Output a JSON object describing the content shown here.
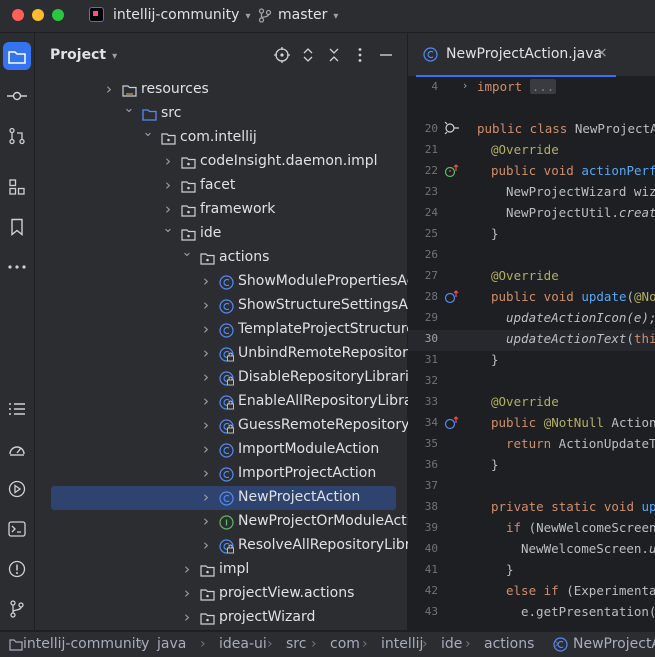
{
  "window": {
    "project_name": "intellij-community",
    "branch": "master"
  },
  "project_panel": {
    "title": "Project",
    "tree": [
      {
        "label": "resources",
        "type": "folder"
      },
      {
        "label": "src",
        "type": "source-folder"
      },
      {
        "label": "com.intellij",
        "type": "package"
      },
      {
        "label": "codeInsight.daemon.impl",
        "type": "package"
      },
      {
        "label": "facet",
        "type": "package"
      },
      {
        "label": "framework",
        "type": "package"
      },
      {
        "label": "ide",
        "type": "package"
      },
      {
        "label": "actions",
        "type": "package"
      },
      {
        "label": "ShowModulePropertiesAction",
        "type": "class"
      },
      {
        "label": "ShowStructureSettingsAction",
        "type": "class"
      },
      {
        "label": "TemplateProjectStructureActi",
        "type": "class"
      },
      {
        "label": "UnbindRemoteRepositoryForA",
        "type": "class-locked"
      },
      {
        "label": "DisableRepositoryLibrariesSha",
        "type": "class-locked"
      },
      {
        "label": "EnableAllRepositoryLibrariesS",
        "type": "class-locked"
      },
      {
        "label": "GuessRemoteRepositoryForEa",
        "type": "class-locked"
      },
      {
        "label": "ImportModuleAction",
        "type": "class"
      },
      {
        "label": "ImportProjectAction",
        "type": "class"
      },
      {
        "label": "NewProjectAction",
        "type": "class",
        "selected": true
      },
      {
        "label": "NewProjectOrModuleAction",
        "type": "interface"
      },
      {
        "label": "ResolveAllRepositoryLibraries",
        "type": "class-locked"
      },
      {
        "label": "impl",
        "type": "package"
      },
      {
        "label": "projectView.actions",
        "type": "package"
      },
      {
        "label": "projectWizard",
        "type": "package"
      }
    ]
  },
  "editor": {
    "tab_label": "NewProjectAction.java",
    "tab_close": "×",
    "line_numbers": [
      "4",
      "20",
      "21",
      "22",
      "23",
      "24",
      "25",
      "26",
      "27",
      "28",
      "29",
      "30",
      "31",
      "32",
      "33",
      "34",
      "35",
      "36",
      "37",
      "38",
      "39",
      "40",
      "41",
      "42",
      "43"
    ],
    "current_line": "30",
    "lines": [
      "import ...",
      "public class NewProjectAc",
      "@Override",
      "public void actionPerfo",
      "NewProjectWizard wiza",
      "NewProjectUtil.create",
      "}",
      "",
      "@Override",
      "public void update(@Not",
      "updateActionIcon(e);",
      "updateActionText(this",
      "}",
      "",
      "@Override",
      "public @NotNull ActionU",
      "return ActionUpdateTh",
      "}",
      "",
      "private static void upd",
      "if (NewWelcomeScreen.",
      "NewWelcomeScreen.up",
      "}",
      "else if (Experimental",
      "e.getPresentation()"
    ]
  },
  "status_bar": {
    "breadcrumbs": [
      "intellij-community",
      "java",
      "idea-ui",
      "src",
      "com",
      "intellij",
      "ide",
      "actions",
      "NewProjectAc"
    ]
  },
  "colors": {
    "accent": "#3574f0",
    "selection": "#2e436e",
    "keyword": "#cf8e6d",
    "annotation": "#b3ae60",
    "method": "#56a8f5"
  }
}
